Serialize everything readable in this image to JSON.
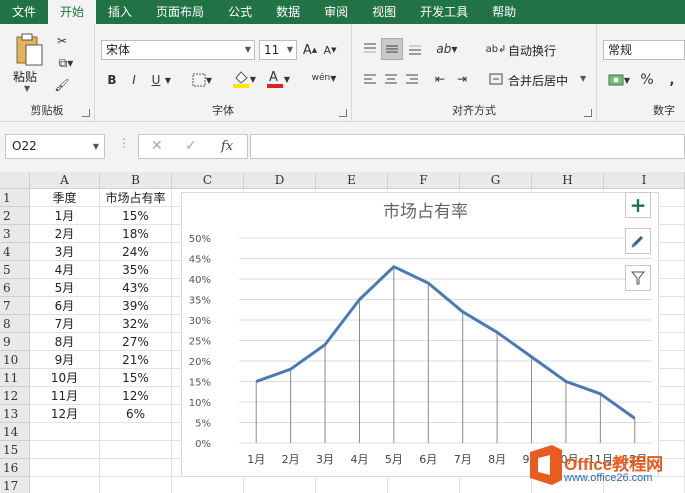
{
  "ribbon_tabs": [
    "文件",
    "开始",
    "插入",
    "页面布局",
    "公式",
    "数据",
    "审阅",
    "视图",
    "开发工具",
    "帮助"
  ],
  "active_tab_index": 1,
  "clipboard": {
    "paste_label": "粘贴",
    "group_label": "剪贴板"
  },
  "font": {
    "name": "宋体",
    "size": "11",
    "group_label": "字体",
    "bold": "B",
    "italic": "I",
    "underline": "U",
    "grow": "A",
    "shrink": "A",
    "phonetic": "wén"
  },
  "alignment": {
    "wrap_text": "自动换行",
    "merge_center": "合并后居中",
    "group_label": "对齐方式"
  },
  "number": {
    "format": "常规",
    "group_label": "数字",
    "percent": "%"
  },
  "formula_bar": {
    "name_box": "O22",
    "fx": "fx",
    "formula": ""
  },
  "columns": [
    "A",
    "B",
    "C",
    "D",
    "E",
    "F",
    "G",
    "H",
    "I"
  ],
  "rows": [
    "1",
    "2",
    "3",
    "4",
    "5",
    "6",
    "7",
    "8",
    "9",
    "10",
    "11",
    "12",
    "13",
    "14",
    "15",
    "16",
    "17"
  ],
  "table": {
    "headers": [
      "季度",
      "市场占有率"
    ],
    "rows": [
      [
        "1月",
        "15%"
      ],
      [
        "2月",
        "18%"
      ],
      [
        "3月",
        "24%"
      ],
      [
        "4月",
        "35%"
      ],
      [
        "5月",
        "43%"
      ],
      [
        "6月",
        "39%"
      ],
      [
        "7月",
        "32%"
      ],
      [
        "8月",
        "27%"
      ],
      [
        "9月",
        "21%"
      ],
      [
        "10月",
        "15%"
      ],
      [
        "11月",
        "12%"
      ],
      [
        "12月",
        "6%"
      ]
    ]
  },
  "chart_data": {
    "type": "line",
    "title": "市场占有率",
    "categories": [
      "1月",
      "2月",
      "3月",
      "4月",
      "5月",
      "6月",
      "7月",
      "8月",
      "9月",
      "10月",
      "11月",
      "12月"
    ],
    "series": [
      {
        "values": [
          15,
          18,
          24,
          35,
          43,
          39,
          32,
          27,
          21,
          15,
          12,
          6
        ]
      }
    ],
    "yticks": [
      "0%",
      "5%",
      "10%",
      "15%",
      "20%",
      "25%",
      "30%",
      "35%",
      "40%",
      "45%",
      "50%"
    ],
    "ylim": [
      0,
      50
    ],
    "grid": true,
    "drop_lines": true,
    "line_color": "#4a7ab5"
  },
  "watermark": {
    "brand": "Office教程网",
    "url": "www.office26.com"
  },
  "colors": {
    "excel_green": "#217346",
    "ribbon_bg": "#f3f3f3",
    "paste_accent": "#d9a441"
  }
}
